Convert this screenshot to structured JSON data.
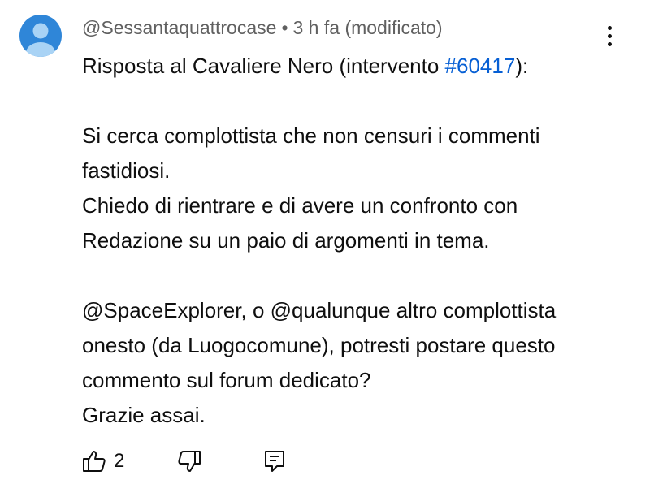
{
  "comment": {
    "author": "@Sessantaquattrocase",
    "separator": "•",
    "time": "3 h fa",
    "edited": "(modificato)",
    "reply_prefix": "Risposta al Cavaliere Nero (intervento ",
    "reply_link": "#60417",
    "reply_suffix": "):",
    "paragraph_1": "Si cerca complottista che non censuri i commenti fastidiosi.",
    "paragraph_2": "Chiedo di rientrare e di avere un confronto con Redazione su un paio di argomenti in tema.",
    "paragraph_3": "@SpaceExplorer, o  @qualunque altro complottista onesto (da Luogocomune), potresti postare questo commento sul forum dedicato?",
    "paragraph_4": "Grazie assai."
  },
  "actions": {
    "like_count": "2"
  },
  "icons": {
    "avatar": "default-avatar-icon",
    "like": "thumb-up-icon",
    "dislike": "thumb-down-icon",
    "reply": "reply-comment-icon",
    "more": "more-vertical-icon"
  },
  "colors": {
    "avatar_bg": "#2f86d8",
    "avatar_figure": "#a9d3f5",
    "link": "#065fd4",
    "meta_text": "#606060"
  }
}
